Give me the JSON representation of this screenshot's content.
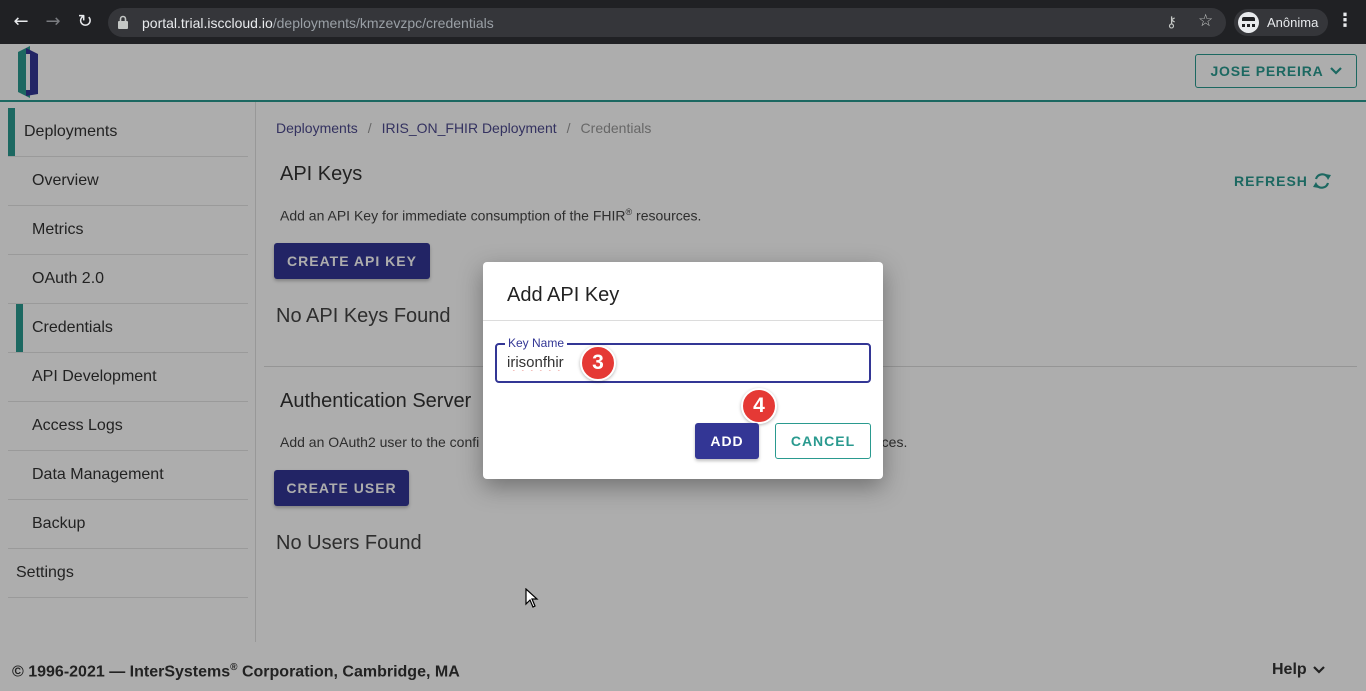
{
  "browser": {
    "url_host": "portal.trial.isccloud.io",
    "url_path": "/deployments/kmzevzpc/credentials",
    "profile_label": "Anônima"
  },
  "header": {
    "user_name": "JOSE PEREIRA"
  },
  "sidebar": {
    "items": [
      {
        "label": "Deployments",
        "level": "top",
        "active": true
      },
      {
        "label": "Overview",
        "level": "sub",
        "active": false
      },
      {
        "label": "Metrics",
        "level": "sub",
        "active": false
      },
      {
        "label": "OAuth 2.0",
        "level": "sub",
        "active": false
      },
      {
        "label": "Credentials",
        "level": "sub",
        "active": true
      },
      {
        "label": "API Development",
        "level": "sub",
        "active": false
      },
      {
        "label": "Access Logs",
        "level": "sub",
        "active": false
      },
      {
        "label": "Data Management",
        "level": "sub",
        "active": false
      },
      {
        "label": "Backup",
        "level": "sub",
        "active": false
      },
      {
        "label": "Settings",
        "level": "top",
        "active": false
      }
    ]
  },
  "breadcrumb": {
    "items": [
      "Deployments",
      "IRIS_ON_FHIR Deployment",
      "Credentials"
    ],
    "separator": "/"
  },
  "api_keys": {
    "title": "API Keys",
    "refresh_label": "REFRESH",
    "description": "Add an API Key for immediate consumption of the FHIR",
    "description_sup": "®",
    "description_tail": " resources.",
    "create_button": "CREATE API KEY",
    "empty_text": "No API Keys Found"
  },
  "auth_server": {
    "title": "Authentication Server",
    "description_start": "Add an OAuth2 user to the confi",
    "description_end": "rces.",
    "create_button": "CREATE USER",
    "empty_text": "No Users Found"
  },
  "dialog": {
    "title": "Add API Key",
    "field_label": "Key Name",
    "field_value": "irisonfhir",
    "add_button": "ADD",
    "cancel_button": "CANCEL",
    "step_badges": [
      "3",
      "4"
    ]
  },
  "footer": {
    "copyright_start": "© 1996-2021 — InterSystems",
    "copyright_sup": "®",
    "copyright_end": " Corporation, Cambridge, MA",
    "help_label": "Help"
  },
  "colors": {
    "primary": "#333695",
    "accent": "#2a9a8f",
    "badge": "#e53935"
  }
}
